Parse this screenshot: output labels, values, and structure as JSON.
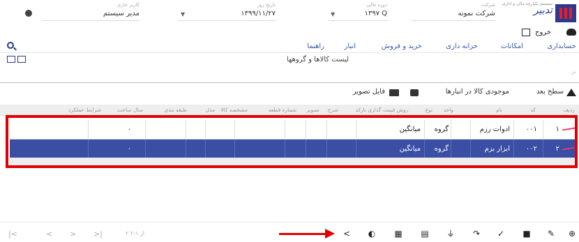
{
  "header": {
    "user_caption": "کاربر جاری",
    "user_value": "مدیر سیستم",
    "date_caption": "تاریخ روز",
    "date_value": "۱۳۹۹/۱۱/۲۷",
    "year_caption": "دوره مالی",
    "year_value": "۱۳۹۷ Q",
    "company_caption": "شرکت",
    "company_value": "شرکت نمونه",
    "logo_text": "تدبیر",
    "logo_sub": "سیستم یکپارچه مالی و اداری"
  },
  "exit_label": "خروج",
  "menu": [
    "حسابداری",
    "امکانات",
    "خزانه داری",
    "خرید و فروش",
    "انبار",
    "راهنما"
  ],
  "page_title": "لیست کالاها و گروهها",
  "hint": "..ش",
  "toolbar": {
    "next_level": "سطح بعد",
    "stock": "موجودی کالا در انبارها",
    "image_file": "فایل تصویر"
  },
  "table": {
    "columns": [
      "ردیف",
      "کد",
      "نام",
      "واحد",
      "نوع",
      "روش قیمت گذاری",
      "بارکد",
      "شرح",
      "تصویر",
      "شماره قطعه",
      "مشخصه کالا",
      "مدل",
      "طبقه بندی",
      "سال ساخت",
      "شرایط عملکرد"
    ],
    "rows": [
      {
        "row": "۱",
        "code": "۰۰۱",
        "name": "ادوات رزم",
        "type": "گروه",
        "pricing": "میانگین",
        "year": "۰"
      },
      {
        "row": "۲",
        "code": "۰۰۲",
        "name": "ابزار بزم",
        "type": "گروه",
        "pricing": "میانگین",
        "year": "۰"
      }
    ]
  },
  "pager": {
    "info": "۲ از ۱-۲",
    "first": "|<",
    "prev": "<",
    "next": ">",
    "last": ">|"
  },
  "colors": {
    "brand": "#2b3990",
    "selected_row": "#3a4ea3",
    "annotation": "#e00000",
    "check": "#e8396b"
  },
  "icons": [
    "share-icon",
    "pie-chart-icon",
    "excel-icon",
    "print-icon",
    "filter-icon",
    "redo-icon",
    "check-all-icon",
    "delete-icon",
    "edit-icon",
    "add-icon"
  ]
}
